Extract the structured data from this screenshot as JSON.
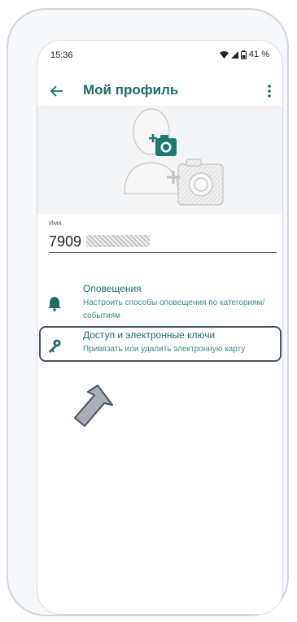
{
  "status_bar": {
    "time": "15:36",
    "battery_percent": "41 %",
    "icons": [
      "wifi-icon",
      "signal-icon",
      "battery-icon"
    ]
  },
  "app_bar": {
    "title": "Мой профиль",
    "back_icon": "arrow-left-icon",
    "menu_icon": "more-vert-icon"
  },
  "profile": {
    "avatar_icon": "person-placeholder-icon",
    "add_photo_icon": "add-photo-camera-icon",
    "name_label": "Имя",
    "name_value": "7909"
  },
  "menu": {
    "items": [
      {
        "title": "Оповещения",
        "subtitle": "Настроить способы оповещения по категориям/событиям",
        "icon": "bell-icon"
      },
      {
        "title": "Доступ и электронные ключи",
        "subtitle": "Привязать или удалить электронную карту",
        "icon": "key-icon"
      }
    ]
  },
  "colors": {
    "accent": "#1d6b67",
    "accent_light": "#3c8a86",
    "highlight_border": "#4a5260",
    "arrow_fill": "#a8aeb5"
  }
}
